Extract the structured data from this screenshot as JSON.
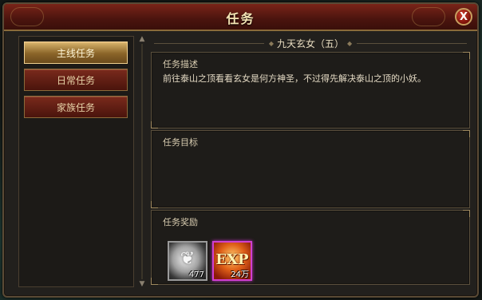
{
  "window": {
    "title": "任务",
    "close_label": "X"
  },
  "sidebar": {
    "tabs": [
      {
        "label": "主线任务",
        "active": true
      },
      {
        "label": "日常任务",
        "active": false
      },
      {
        "label": "家族任务",
        "active": false
      }
    ]
  },
  "quest": {
    "name": "九天玄女（五）",
    "description_label": "任务描述",
    "description": "前往泰山之顶看看玄女是何方神圣，不过得先解决泰山之顶的小妖。",
    "objective_label": "任务目标",
    "rewards_label": "任务奖励",
    "rewards": [
      {
        "icon": "silver-ingot-icon",
        "quantity": "477"
      },
      {
        "icon": "exp-icon",
        "name": "EXP",
        "quantity": "24万"
      }
    ]
  },
  "colors": {
    "title_bar": "#7a2418",
    "active_tab": "#d8b46c",
    "tab": "#7a2a1c",
    "exp_border": "#d040d0"
  }
}
